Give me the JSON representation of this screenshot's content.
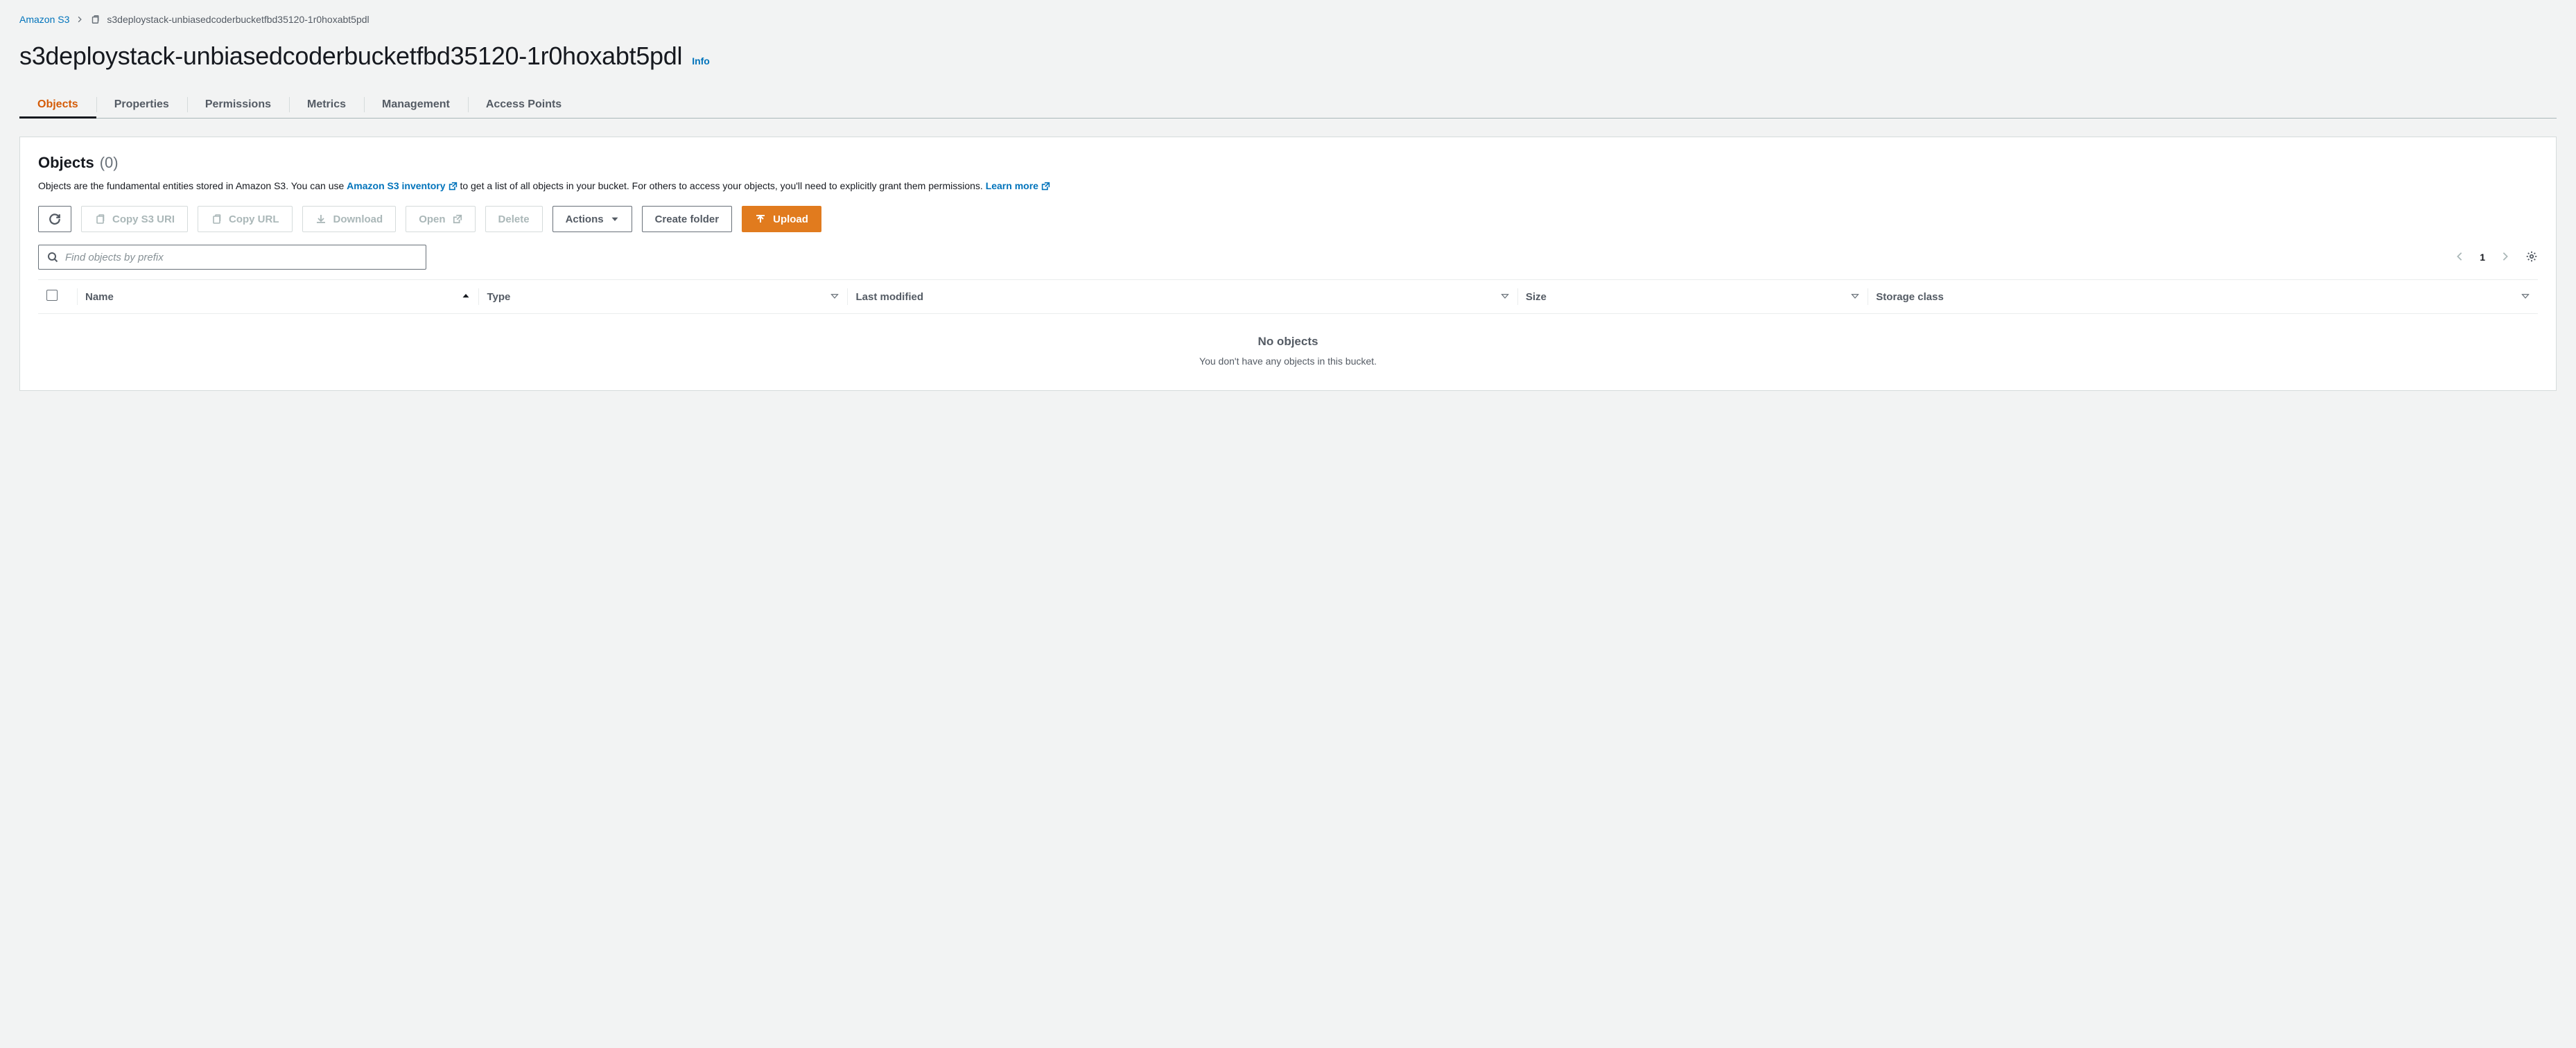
{
  "breadcrumb": {
    "root": "Amazon S3",
    "current": "s3deploystack-unbiasedcoderbucketfbd35120-1r0hoxabt5pdl"
  },
  "header": {
    "title": "s3deploystack-unbiasedcoderbucketfbd35120-1r0hoxabt5pdl",
    "info": "Info"
  },
  "tabs": [
    {
      "id": "objects",
      "label": "Objects",
      "active": true
    },
    {
      "id": "properties",
      "label": "Properties",
      "active": false
    },
    {
      "id": "permissions",
      "label": "Permissions",
      "active": false
    },
    {
      "id": "metrics",
      "label": "Metrics",
      "active": false
    },
    {
      "id": "management",
      "label": "Management",
      "active": false
    },
    {
      "id": "access-points",
      "label": "Access Points",
      "active": false
    }
  ],
  "panel": {
    "title": "Objects",
    "count": "(0)",
    "desc_pre": "Objects are the fundamental entities stored in Amazon S3. You can use ",
    "inventory_link": "Amazon S3 inventory",
    "desc_mid": " to get a list of all objects in your bucket. For others to access your objects, you'll need to explicitly grant them permissions. ",
    "learn_more": "Learn more"
  },
  "toolbar": {
    "copy_s3_uri": "Copy S3 URI",
    "copy_url": "Copy URL",
    "download": "Download",
    "open": "Open",
    "delete": "Delete",
    "actions": "Actions",
    "create_folder": "Create folder",
    "upload": "Upload"
  },
  "search": {
    "placeholder": "Find objects by prefix"
  },
  "pagination": {
    "page": "1"
  },
  "table": {
    "columns": [
      "Name",
      "Type",
      "Last modified",
      "Size",
      "Storage class"
    ],
    "rows": []
  },
  "empty": {
    "title": "No objects",
    "subtitle": "You don't have any objects in this bucket."
  }
}
